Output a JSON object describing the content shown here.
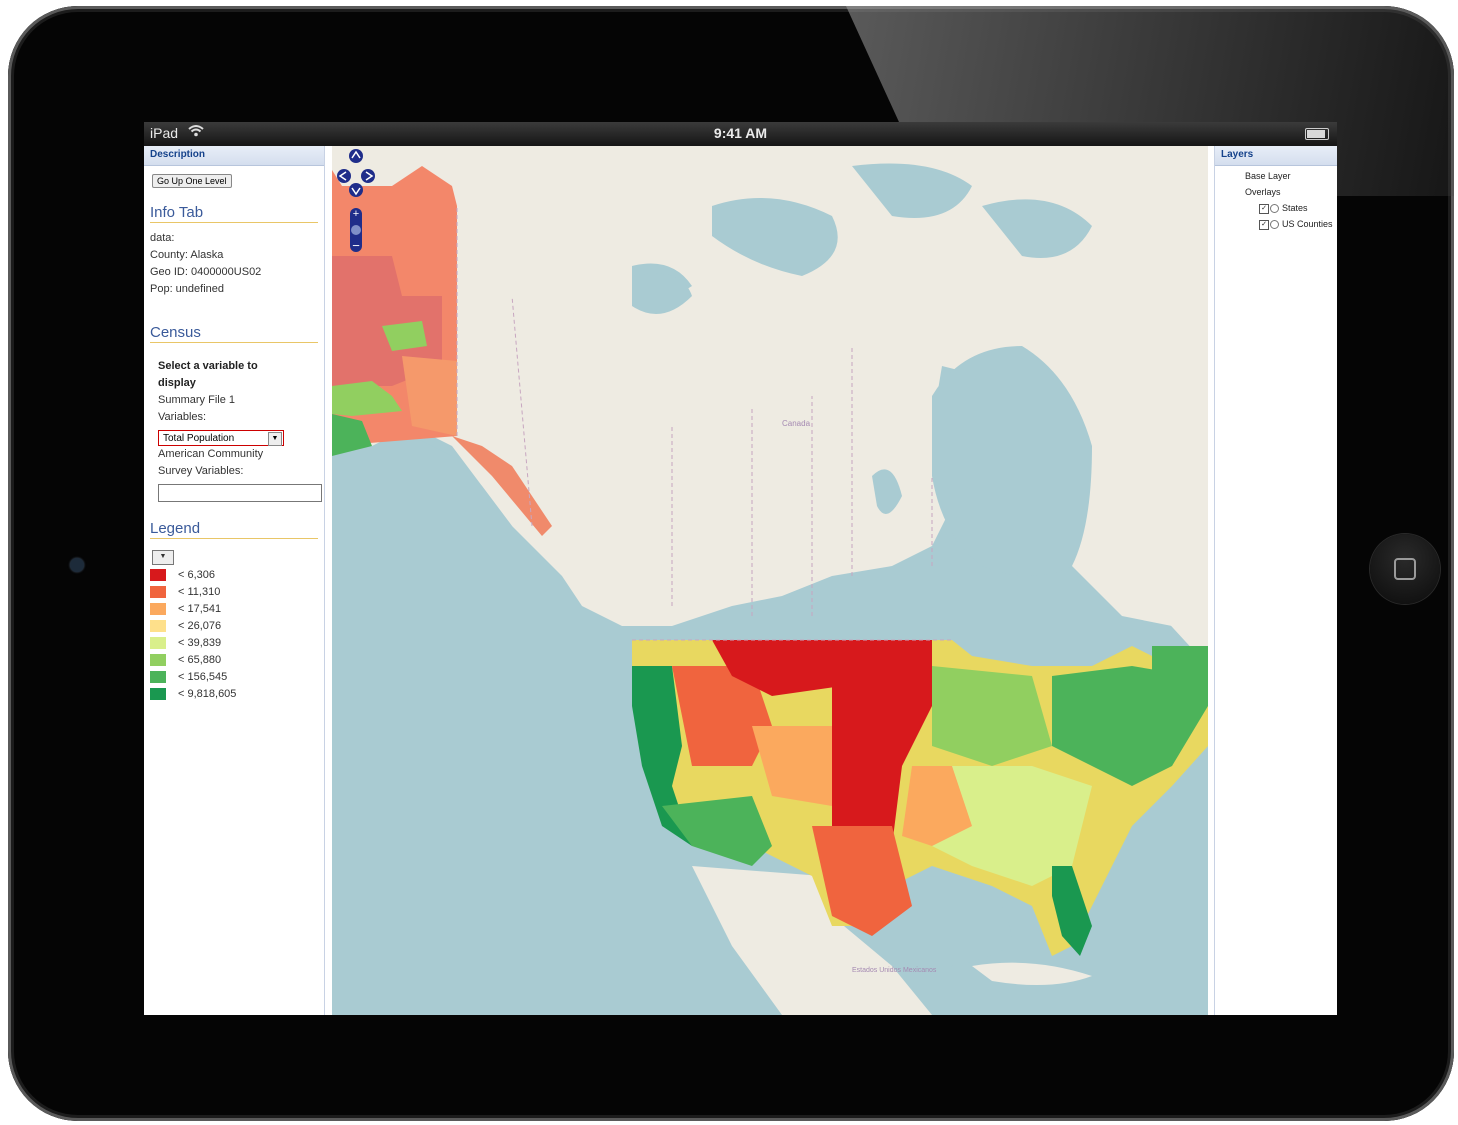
{
  "status_bar": {
    "device": "iPad",
    "time": "9:41 AM"
  },
  "left_panel": {
    "header": "Description",
    "go_up_button": "Go Up One Level",
    "info_tab": {
      "title": "Info Tab",
      "lines": [
        "data:",
        "County: Alaska",
        "Geo ID: 0400000US02",
        "Pop: undefined"
      ]
    },
    "census": {
      "title": "Census",
      "prompt_line1": "Select a variable to",
      "prompt_line2": "display",
      "sf1_line1": "Summary File 1",
      "sf1_line2": "Variables:",
      "selected_variable": "Total Population",
      "acs_line1": "American Community",
      "acs_line2": "Survey Variables:",
      "acs_value": ""
    },
    "legend": {
      "title": "Legend",
      "items": [
        {
          "label": "< 6,306",
          "color": "#d7191c"
        },
        {
          "label": "< 11,310",
          "color": "#f0643e"
        },
        {
          "label": "< 17,541",
          "color": "#fba95e"
        },
        {
          "label": "< 26,076",
          "color": "#fee08b"
        },
        {
          "label": "< 39,839",
          "color": "#d9ef8b"
        },
        {
          "label": "< 65,880",
          "color": "#91cf60"
        },
        {
          "label": "< 156,545",
          "color": "#4cb35a"
        },
        {
          "label": "< 9,818,605",
          "color": "#1a9850"
        }
      ]
    }
  },
  "map": {
    "label_canada": "Canada",
    "label_mexico": "Estados Unidos Mexicanos"
  },
  "right_panel": {
    "header": "Layers",
    "base_layer": "Base Layer",
    "overlays": "Overlays",
    "layers": [
      {
        "label": "States",
        "checked": true
      },
      {
        "label": "US Counties",
        "checked": true
      }
    ]
  }
}
